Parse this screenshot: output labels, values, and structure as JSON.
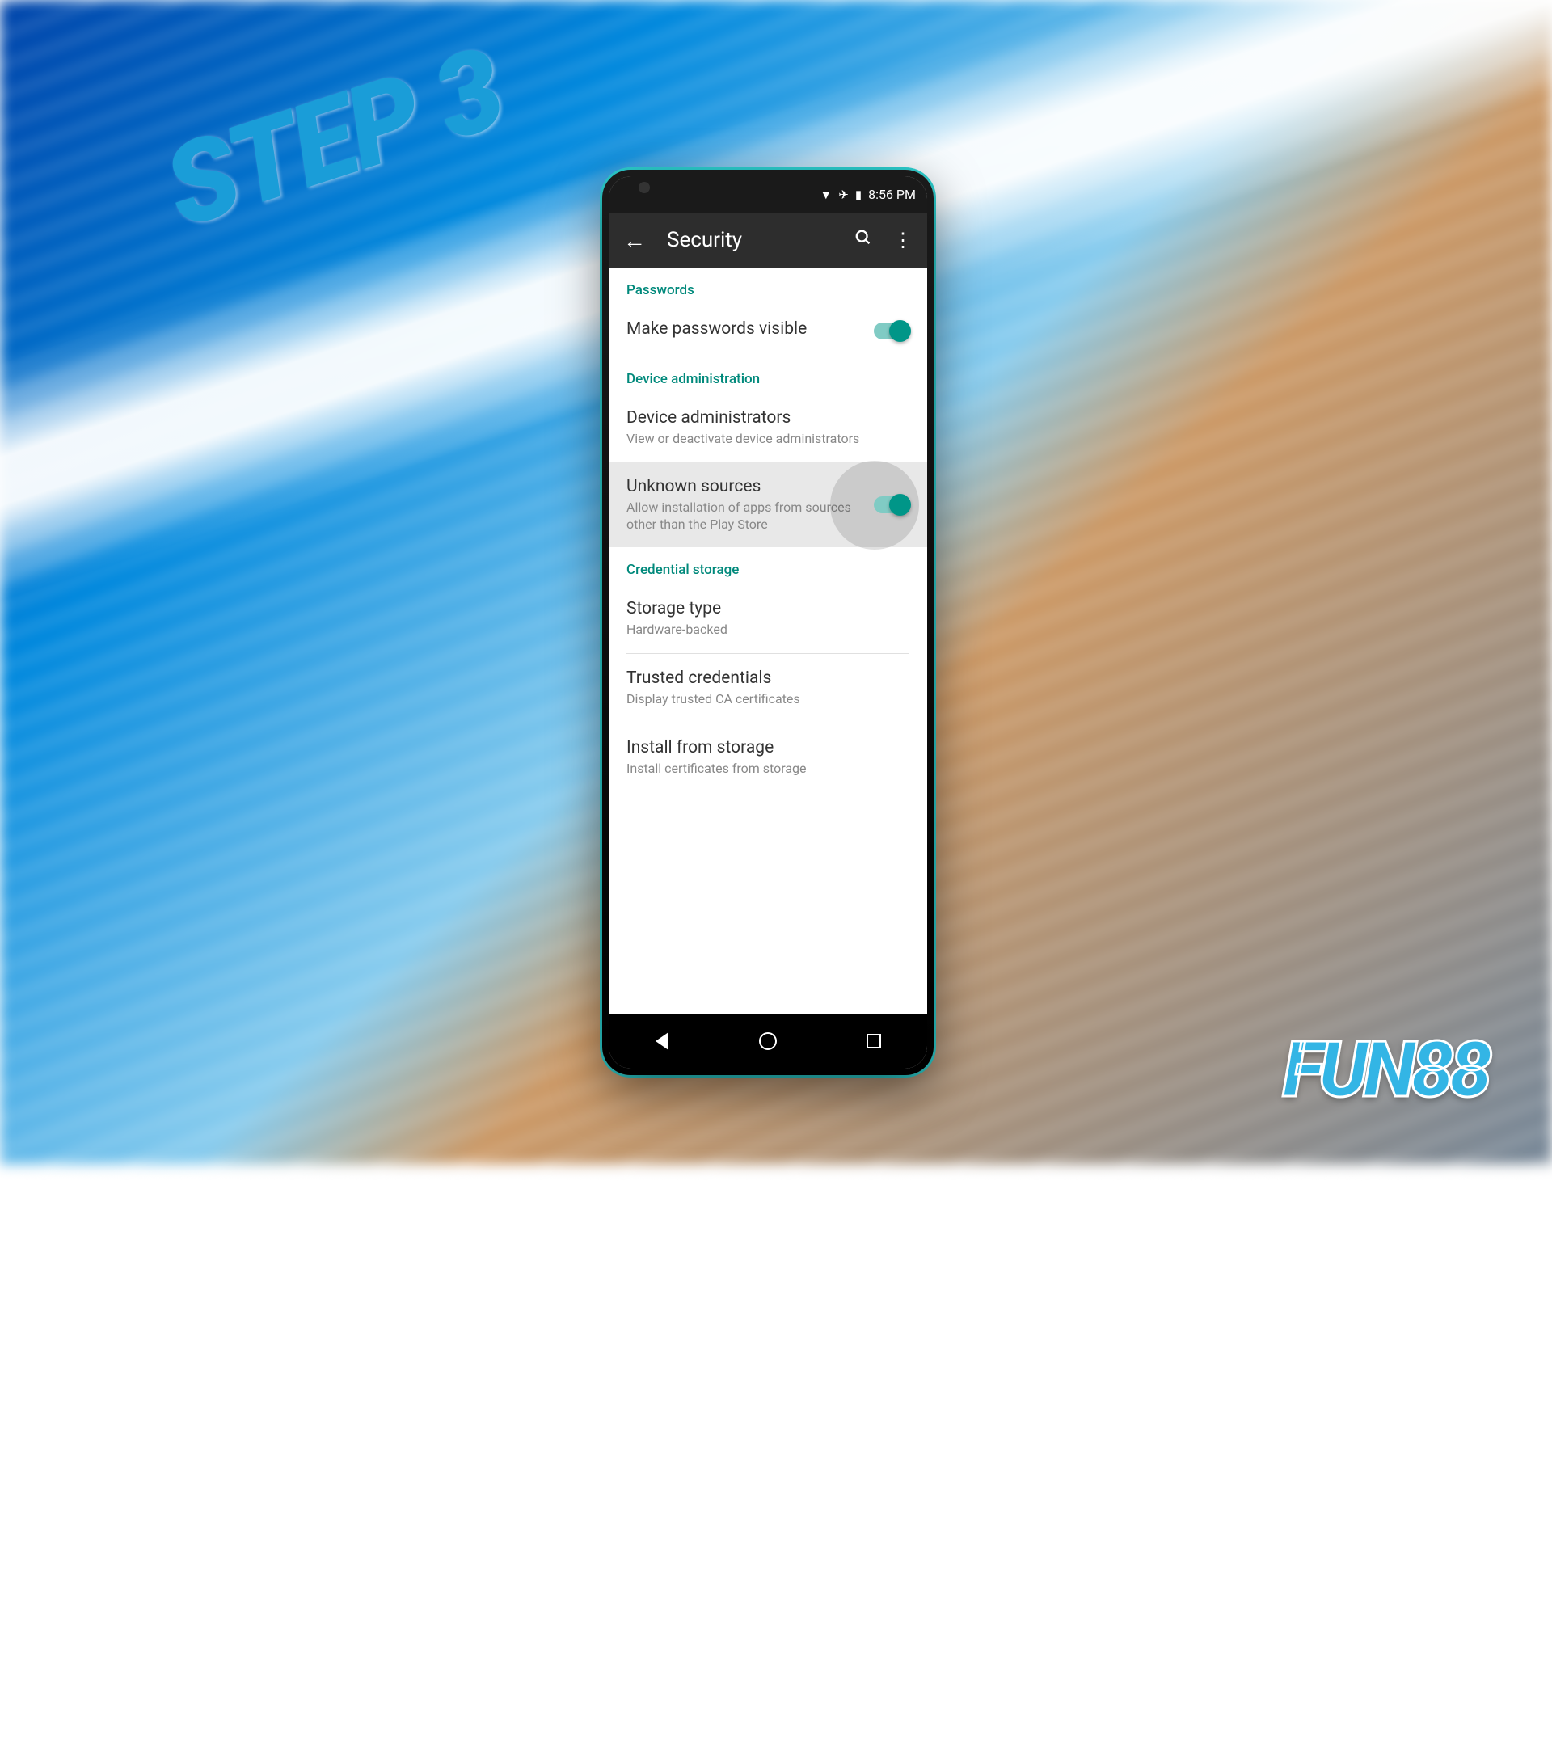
{
  "promo": {
    "step_label": "STEP 3",
    "brand": "FUN88"
  },
  "status_bar": {
    "time": "8:56 PM"
  },
  "app_bar": {
    "title": "Security"
  },
  "sections": {
    "passwords": {
      "header": "Passwords",
      "make_visible": {
        "title": "Make passwords visible"
      }
    },
    "device_admin": {
      "header": "Device administration",
      "administrators": {
        "title": "Device administrators",
        "subtitle": "View or deactivate device administrators"
      },
      "unknown_sources": {
        "title": "Unknown sources",
        "subtitle": "Allow installation of apps from sources other than the Play Store"
      }
    },
    "credential_storage": {
      "header": "Credential storage",
      "storage_type": {
        "title": "Storage type",
        "subtitle": "Hardware-backed"
      },
      "trusted_credentials": {
        "title": "Trusted credentials",
        "subtitle": "Display trusted CA certificates"
      },
      "install_storage": {
        "title": "Install from storage",
        "subtitle": "Install certificates from storage"
      }
    }
  }
}
